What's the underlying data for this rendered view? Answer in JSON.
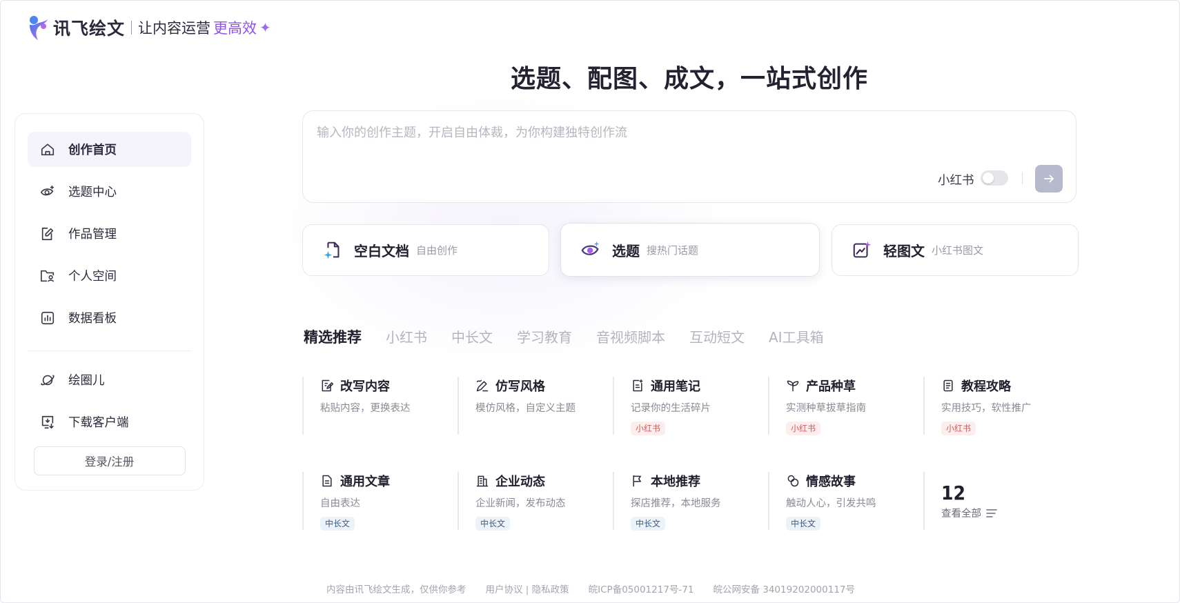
{
  "header": {
    "brand": "讯飞绘文",
    "slogan": "让内容运营",
    "slogan_em": "更高效",
    "colors": {
      "accent": "#8e54e6",
      "logo_blue": "#3d7bf0",
      "logo_purple": "#b766e8"
    }
  },
  "sidebar": {
    "items": [
      {
        "label": "创作首页",
        "icon": "home-icon",
        "active": true
      },
      {
        "label": "选题中心",
        "icon": "eye-sparkle-icon"
      },
      {
        "label": "作品管理",
        "icon": "edit-doc-icon"
      },
      {
        "label": "个人空间",
        "icon": "folder-user-icon"
      },
      {
        "label": "数据看板",
        "icon": "chart-board-icon"
      }
    ],
    "extra": [
      {
        "label": "绘圈儿",
        "icon": "planet-icon"
      },
      {
        "label": "下载客户端",
        "icon": "download-monitor-icon"
      }
    ],
    "login_label": "登录/注册"
  },
  "main": {
    "title": "选题、配图、成文，一站式创作",
    "prompt": {
      "placeholder": "输入你的创作主题，开启自由体裁，为你构建独特创作流",
      "value": "",
      "platform_label": "小红书",
      "platform_toggle_on": false
    },
    "modes": [
      {
        "title": "空白文档",
        "sub": "自由创作",
        "icon": "blank-doc-icon"
      },
      {
        "title": "选题",
        "sub": "搜热门话题",
        "icon": "topic-eye-icon"
      },
      {
        "title": "轻图文",
        "sub": "小红书图文",
        "icon": "image-text-icon"
      }
    ],
    "tabs": [
      "精选推荐",
      "小红书",
      "中长文",
      "学习教育",
      "音视频脚本",
      "互动短文",
      "AI工具箱"
    ],
    "active_tab": "精选推荐",
    "templates": [
      {
        "title": "改写内容",
        "desc": "粘贴内容，更换表达",
        "badge": "",
        "icon": "rewrite-icon"
      },
      {
        "title": "仿写风格",
        "desc": "模仿风格，自定义主题",
        "badge": "",
        "icon": "imitate-pen-icon"
      },
      {
        "title": "通用笔记",
        "desc": "记录你的生活碎片",
        "badge": "小红书",
        "badge_color": "red",
        "icon": "note-icon"
      },
      {
        "title": "产品种草",
        "desc": "实测种草拔草指南",
        "badge": "小红书",
        "badge_color": "red",
        "icon": "sprout-icon"
      },
      {
        "title": "教程攻略",
        "desc": "实用技巧，软性推广",
        "badge": "小红书",
        "badge_color": "red",
        "icon": "tutorial-book-icon"
      },
      {
        "title": "通用文章",
        "desc": "自由表达",
        "badge": "中长文",
        "badge_color": "blue",
        "icon": "article-icon"
      },
      {
        "title": "企业动态",
        "desc": "企业新闻，发布动态",
        "badge": "中长文",
        "badge_color": "blue",
        "icon": "building-icon"
      },
      {
        "title": "本地推荐",
        "desc": "探店推荐，本地服务",
        "badge": "中长文",
        "badge_color": "blue",
        "icon": "flag-icon"
      },
      {
        "title": "情感故事",
        "desc": "触动人心，引发共鸣",
        "badge": "中长文",
        "badge_color": "blue",
        "icon": "heart-bubbles-icon"
      }
    ],
    "view_all": {
      "count": "12",
      "label": "查看全部"
    }
  },
  "footer": {
    "notice": "内容由讯飞绘文生成，仅供你参考",
    "links": "用户协议 | 隐私政策",
    "icp": "皖ICP备05001217号-71",
    "police": "皖公网安备 34019202000117号"
  }
}
